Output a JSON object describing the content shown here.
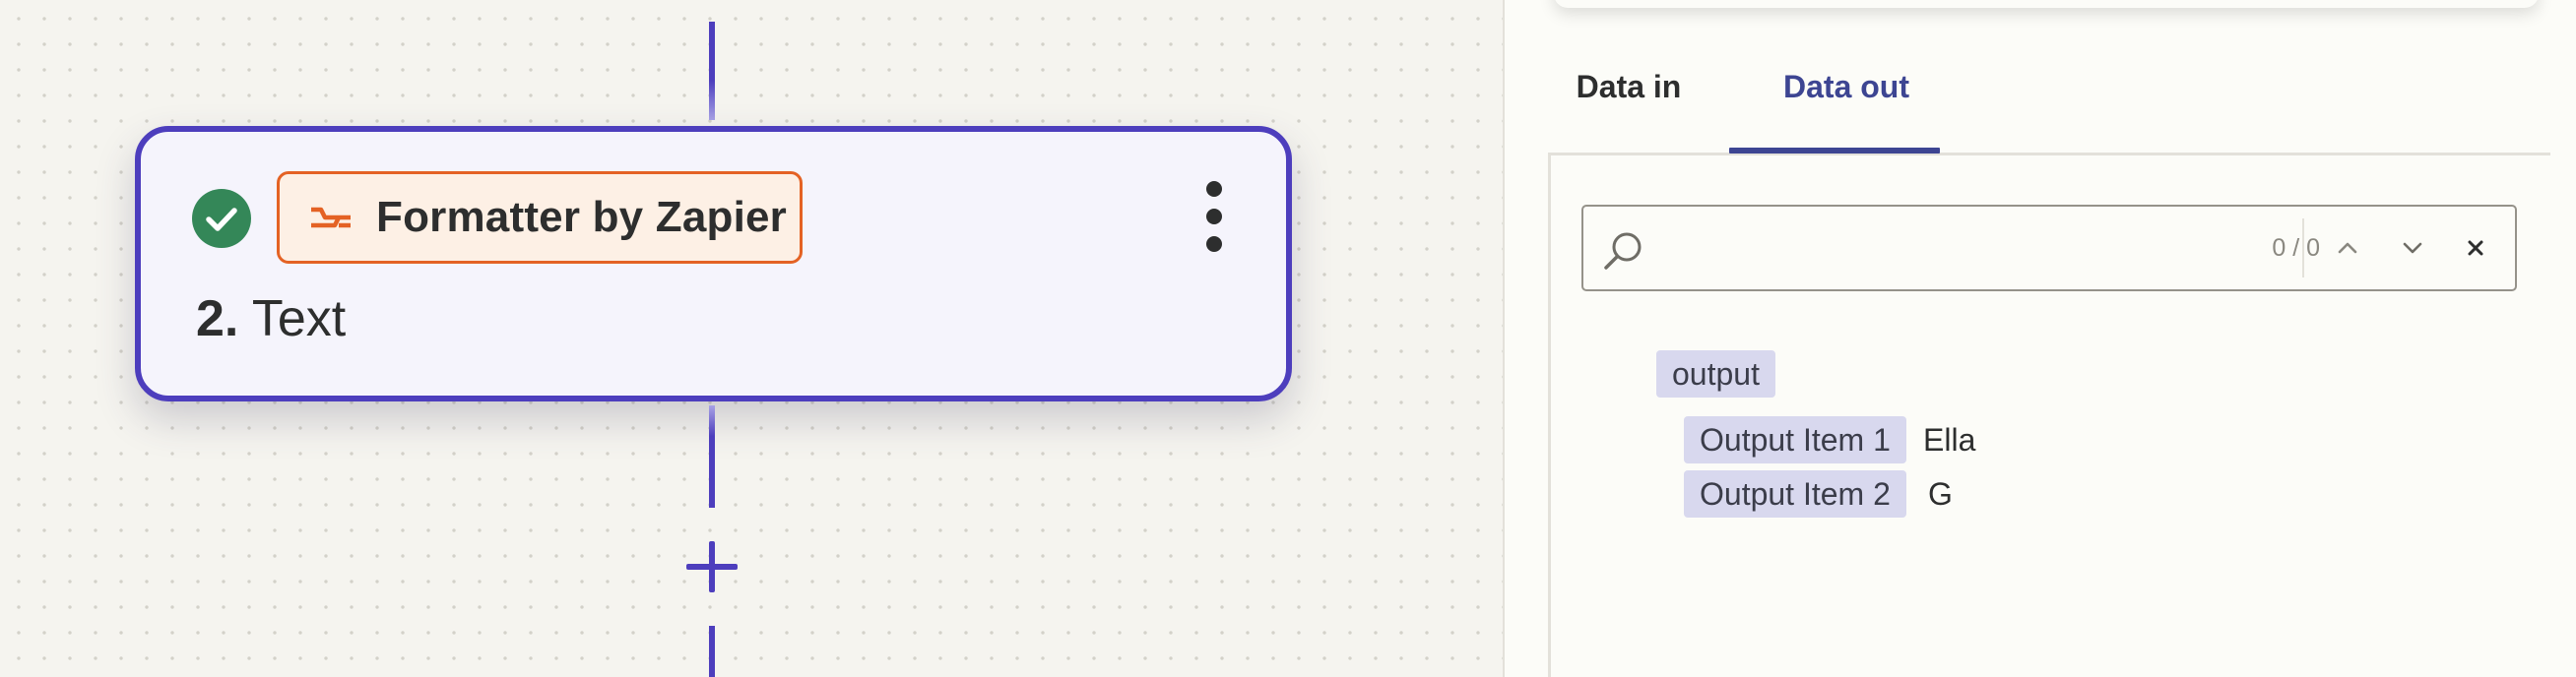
{
  "step": {
    "app_name": "Formatter by Zapier",
    "number": "2.",
    "title": "Text",
    "status": "success"
  },
  "panel": {
    "tabs": [
      {
        "label": "Data in",
        "active": false
      },
      {
        "label": "Data out",
        "active": true
      }
    ],
    "search": {
      "value": "",
      "placeholder": "",
      "match_count": "0 / 0"
    },
    "output": {
      "key": "output",
      "items": [
        {
          "key": "Output Item 1",
          "value": "Ella"
        },
        {
          "key": "Output Item 2",
          "value": "G"
        }
      ]
    }
  },
  "icons": {
    "status": "check-circle-icon",
    "app": "formatter-icon",
    "more": "more-vertical-icon",
    "add": "plus-icon",
    "search": "search-icon",
    "prev": "chevron-up-icon",
    "next": "chevron-down-icon",
    "clear": "close-icon"
  },
  "colors": {
    "accent": "#4d3ebd",
    "success": "#348758",
    "formatter": "#e46224",
    "tab_active": "#3d4592"
  }
}
